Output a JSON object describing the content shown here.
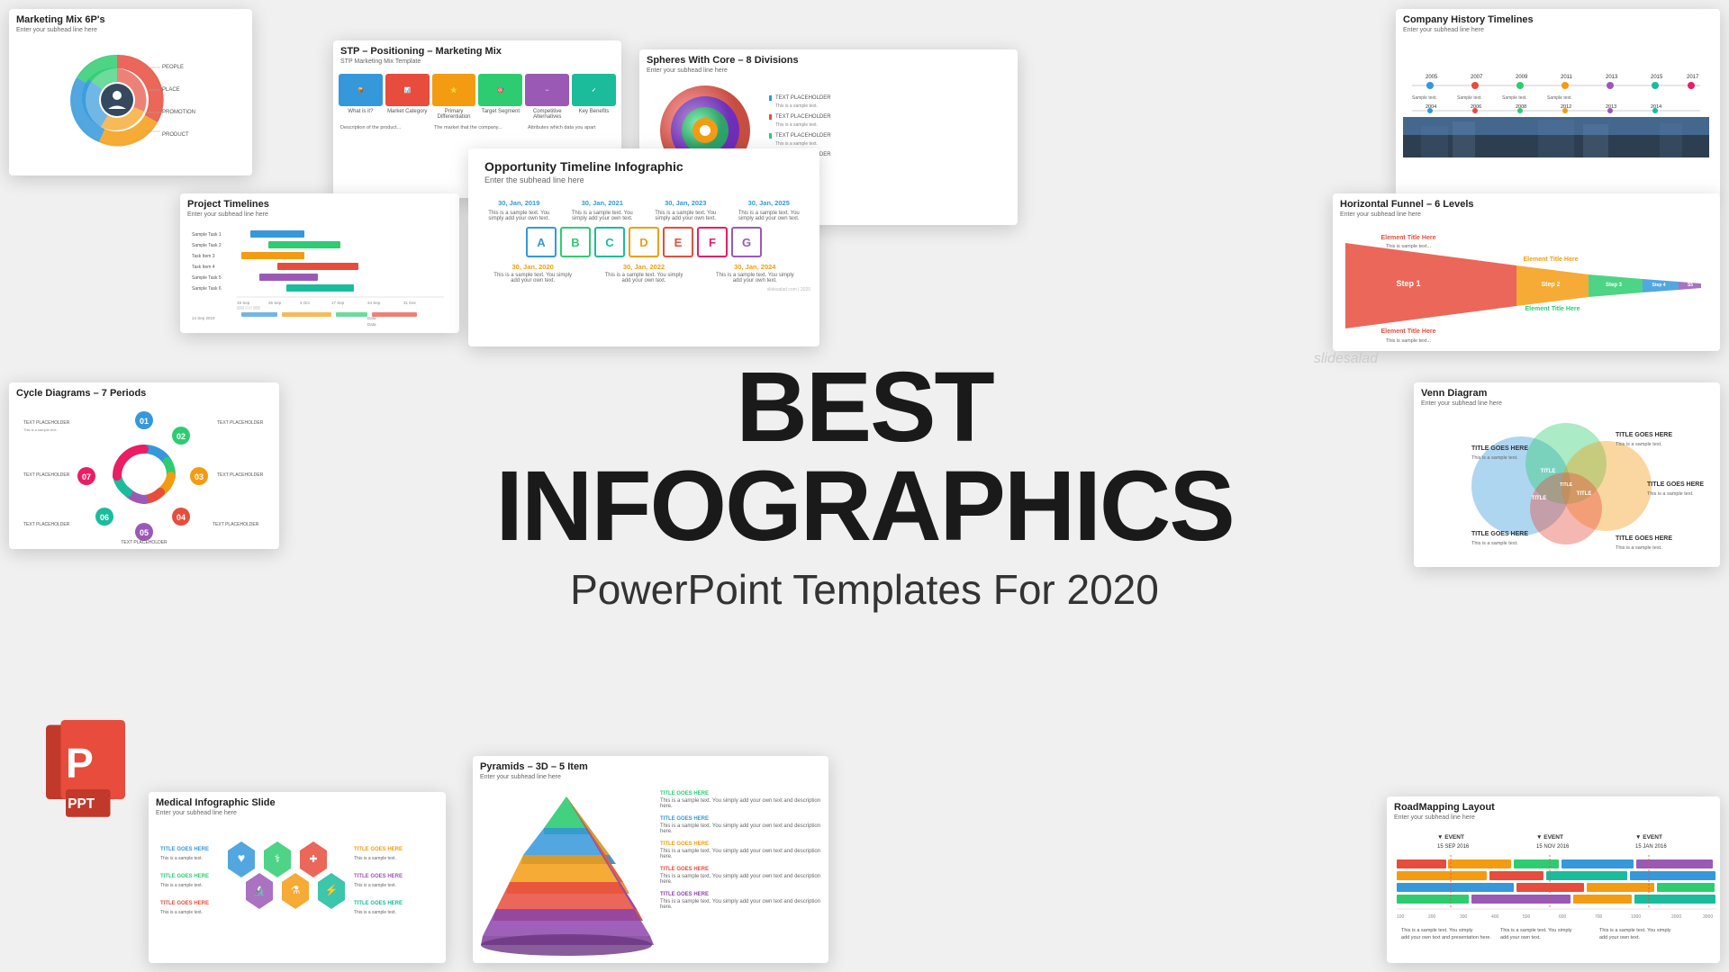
{
  "main": {
    "title": "BEST INFOGRAPHICS",
    "subtitle": "PowerPoint Templates For 2020"
  },
  "cards": {
    "marketing_mix": {
      "title": "Marketing Mix 6P's",
      "subtitle": "Enter your subhead line here"
    },
    "stp": {
      "title": "STP – Positioning – Marketing Mix",
      "subtitle": "STP Marketing Mix Template"
    },
    "spheres": {
      "title": "Spheres With Core – 8 Divisions",
      "subtitle": "Enter your subhead line here"
    },
    "company": {
      "title": "Company History Timelines",
      "subtitle": "Enter your subhead line here"
    },
    "opportunity": {
      "title": "Opportunity Timeline Infographic",
      "subtitle": "Enter the subhead line here"
    },
    "project": {
      "title": "Project Timelines",
      "subtitle": "Enter your subhead line here"
    },
    "funnel": {
      "title": "Horizontal Funnel – 6 Levels",
      "subtitle": "Enter your subhead line here"
    },
    "cycle": {
      "title": "Cycle Diagrams – 7 Periods",
      "subtitle": ""
    },
    "venn": {
      "title": "Venn Diagram",
      "subtitle": "Enter your subhead line here"
    },
    "medical": {
      "title": "Medical Infographic Slide",
      "subtitle": "Enter your subhead line here"
    },
    "pyramids": {
      "title": "Pyramids – 3D – 5 Item",
      "subtitle": "Enter your subhead line here"
    },
    "roadmap": {
      "title": "RoadMapping Layout",
      "subtitle": "Enter your subhead line here"
    }
  },
  "slidesalad": {
    "text": "slidesalad"
  },
  "colors": {
    "teal": "#2eb8b8",
    "orange": "#f5821f",
    "green": "#4caf50",
    "red": "#e74c3c",
    "blue": "#3498db",
    "purple": "#9b59b6",
    "yellow": "#f1c40f",
    "pink": "#e91e8c",
    "dark": "#1a1a1a"
  }
}
